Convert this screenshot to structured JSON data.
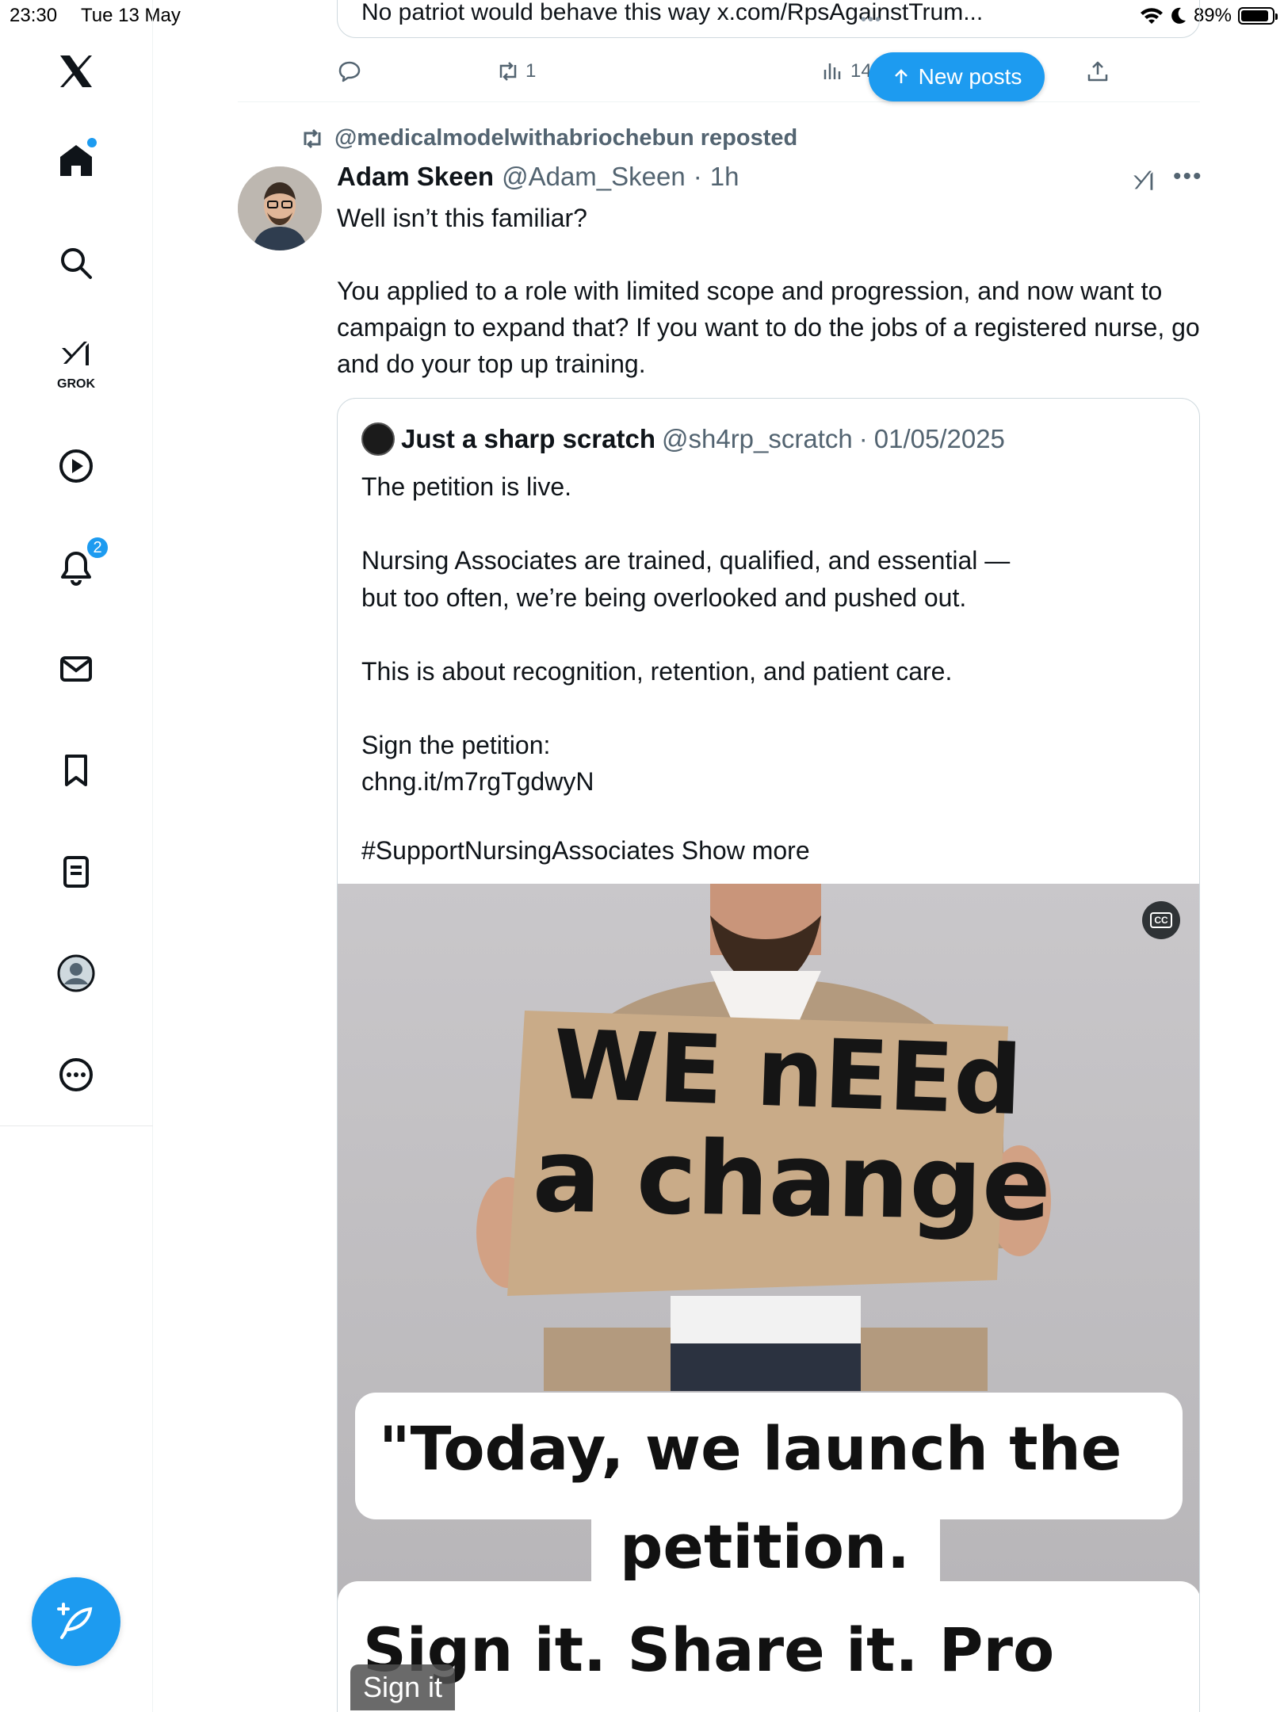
{
  "status_bar": {
    "time": "23:30",
    "date": "Tue 13 May",
    "battery": "89%"
  },
  "nav": {
    "grok_label": "GROK",
    "notifications_count": "2"
  },
  "prev_post": {
    "quote_text": "No patriot would behave this way x.com/RpsAgainstTrum...",
    "retweets": "1",
    "views": "144"
  },
  "new_posts_label": "New posts",
  "post": {
    "reposted_by": "@medicalmodelwithabriochebun reposted",
    "author_name": "Adam Skeen",
    "author_handle": "@Adam_Skeen",
    "time": "1h",
    "text": "Well isn’t this familiar?\n\nYou applied to a role with limited scope and progression, and now want to campaign to expand that? If you want to do the jobs of a registered nurse, go and do your top up training."
  },
  "quote": {
    "name": "Just a sharp scratch",
    "handle": "@sh4rp_scratch",
    "date": "01/05/2025",
    "text": "The petition is live.\n\nNursing Associates are trained, qualified, and essential —\nbut too often, we’re being overlooked and pushed out.\n\nThis is about recognition, retention, and patient care.\n\nSign the petition:\nchng.it/m7rgTgdwyN",
    "hashtag": "#SupportNursingAssociates",
    "show_more": "Show more"
  },
  "media": {
    "sign_line1": "WE nEEd",
    "sign_line2": "a change",
    "caption_line1": "\"Today, we launch the",
    "caption_line2": "petition.",
    "caption_line3": "Sign it. Share it. Pro",
    "pill": "Sign it",
    "cc": "CC"
  },
  "colors": {
    "accent": "#1d9bf0",
    "muted": "#536471",
    "border": "#cfd9de"
  }
}
